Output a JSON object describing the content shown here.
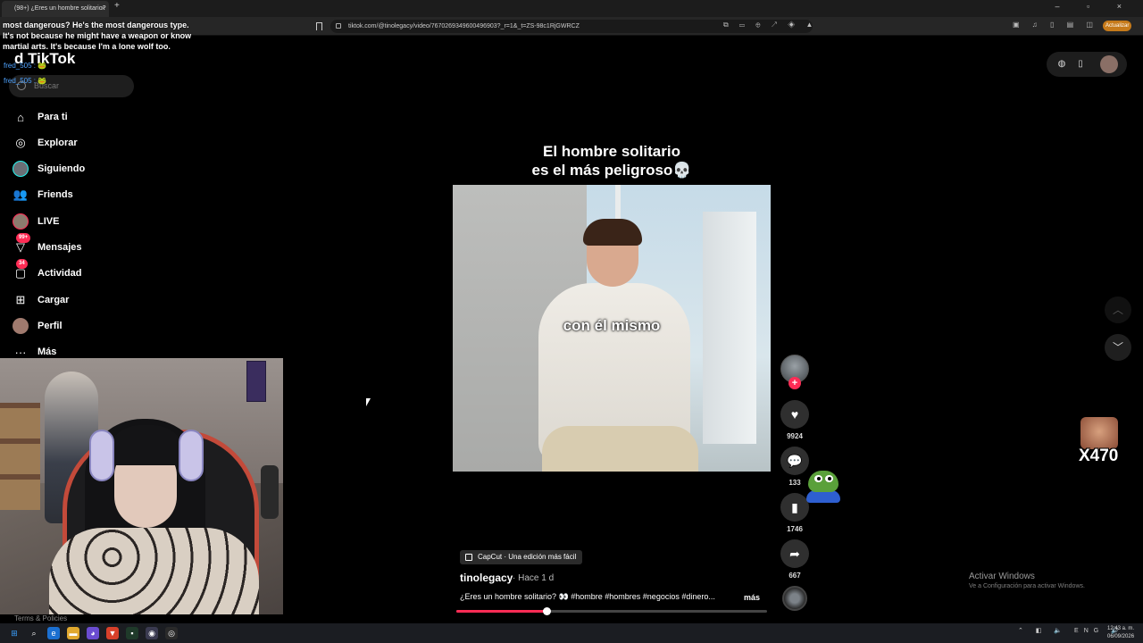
{
  "browser": {
    "tab_title": "(98+) ¿Eres un hombre solitario?",
    "tab_close": "×",
    "new_tab": "+",
    "window_controls": "– ▫ ×",
    "url": "tiktok.com/@tinolegacy/video/7670269349600496903?_r=1&_t=ZS-98c1RjGWRCZ",
    "update_label": "Actualizar"
  },
  "chat": {
    "message": "most dangerous? He's the most dangerous type. It's not because he might have a weapon or know martial arts. It's because I'm a lone wolf too.",
    "user1": "fred_505 : 🐸",
    "user2": "fred_505 : 🐸"
  },
  "sidebar": {
    "logo": "d TikTok",
    "search_placeholder": "Buscar",
    "items": [
      {
        "label": "Para ti",
        "icon": "home-icon",
        "glyph": "⌂"
      },
      {
        "label": "Explorar",
        "icon": "compass-icon",
        "glyph": "◎"
      },
      {
        "label": "Siguiendo",
        "icon": "following-avatar-icon",
        "glyph": ""
      },
      {
        "label": "Friends",
        "icon": "friends-icon",
        "glyph": "👥"
      },
      {
        "label": "LIVE",
        "icon": "live-avatar-icon",
        "glyph": ""
      },
      {
        "label": "Mensajes",
        "icon": "messages-icon",
        "glyph": "▽",
        "badge": "99+"
      },
      {
        "label": "Actividad",
        "icon": "activity-icon",
        "glyph": "▢",
        "badge": "34"
      },
      {
        "label": "Cargar",
        "icon": "upload-icon",
        "glyph": "⊞"
      },
      {
        "label": "Perfil",
        "icon": "profile-avatar-icon",
        "glyph": ""
      },
      {
        "label": "Más",
        "icon": "more-icon",
        "glyph": "···"
      }
    ],
    "terms": "Terms & Policies"
  },
  "video": {
    "title_line1": "El hombre solitario",
    "title_line2": "es el más peligroso💀",
    "caption": "con él mismo",
    "progress": 0.29
  },
  "actions": {
    "likes": "9924",
    "comments": "133",
    "saves": "1746",
    "shares": "667"
  },
  "meta": {
    "capcut": "CapCut · Una edición más fácil",
    "author": "tinolegacy",
    "posted": "· Hace 1 d",
    "description": "¿Eres un hombre solitario? 👀 #hombre #hombres #negocios #dinero...",
    "more": "más"
  },
  "overlay": {
    "counter": "X470",
    "activate_title": "Activar Windows",
    "activate_sub": "Ve a Configuración para activar Windows."
  },
  "taskbar": {
    "tray": "⌃ ◧ 🔈 ENG 🔊",
    "time": "12:43 a. m.",
    "date": "06/09/2026"
  }
}
